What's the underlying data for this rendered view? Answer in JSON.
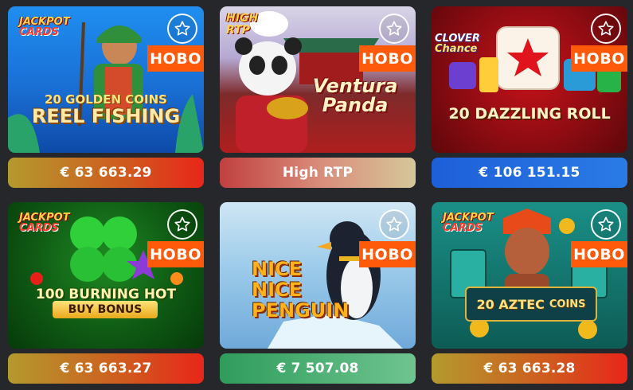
{
  "tiles": [
    {
      "brand_line1": "JACKPOT",
      "brand_line2": "CARDS",
      "subtitle": "20 GOLDEN COINS",
      "title": "REEL FISHING",
      "badge": "HOBO",
      "bar": "€ 63 663.29"
    },
    {
      "brand_line1": "HIGH",
      "brand_line2": "RTP",
      "title": "Ventura Panda",
      "badge": "HOBO",
      "bar": "High RTP"
    },
    {
      "brand_line1": "CLOVER",
      "brand_line2": "Chance",
      "title": "20 DAZZLING ROLL",
      "badge": "HOBO",
      "bar": "€ 106 151.15"
    },
    {
      "brand_line1": "JACKPOT",
      "brand_line2": "CARDS",
      "title": "100 BURNING HOT",
      "subtitle": "BUY BONUS",
      "badge": "HOBO",
      "bar": "€ 63 663.27"
    },
    {
      "title_l1": "NICE",
      "title_l2": "NICE",
      "title_l3": "PENGUIN",
      "badge": "HOBO",
      "bar": "€ 7 507.08"
    },
    {
      "brand_line1": "JACKPOT",
      "brand_line2": "CARDS",
      "title_l1": "20 AZTEC",
      "title_l2": "COINS",
      "badge": "HOBO",
      "bar": "€ 63 663.28"
    }
  ],
  "icons": {
    "favorite": "star-outline-icon"
  }
}
